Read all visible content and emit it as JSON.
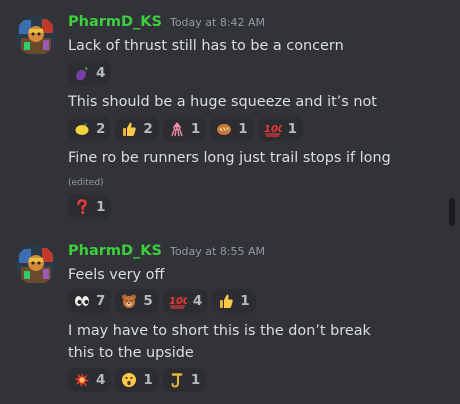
{
  "messages": [
    {
      "author": "PharmD_KS",
      "timestamp": "Today at 8:42 AM",
      "lines": [
        {
          "text": "Lack of thrust still has to be a concern",
          "reactions": [
            {
              "icon": "eggplant-emoji",
              "count": "4"
            }
          ]
        },
        {
          "text": "This should be a huge squeeze and it’s not",
          "reactions": [
            {
              "icon": "lemon-emoji",
              "count": "2"
            },
            {
              "icon": "thumbs-up-emoji",
              "count": "2"
            },
            {
              "icon": "squid-emoji",
              "count": "1"
            },
            {
              "icon": "bread-emoji",
              "count": "1"
            },
            {
              "icon": "hundred-points-emoji",
              "count": "1"
            }
          ]
        },
        {
          "text": "Fine ro be runners long just trail stops if long",
          "edited": "(edited)",
          "reactions": [
            {
              "icon": "question-mark-emoji",
              "count": "1"
            }
          ]
        }
      ]
    },
    {
      "author": "PharmD_KS",
      "timestamp": "Today at 8:55 AM",
      "lines": [
        {
          "text": "Feels very off",
          "reactions": [
            {
              "icon": "eyes-emoji",
              "count": "7"
            },
            {
              "icon": "bear-face-emoji",
              "count": "5"
            },
            {
              "icon": "hundred-points-emoji",
              "count": "4"
            },
            {
              "icon": "thumbs-up-emoji",
              "count": "1"
            }
          ]
        },
        {
          "text": "I may have to short this is the don’t break this to the upside",
          "reactions": [
            {
              "icon": "collision-emoji",
              "count": "4"
            },
            {
              "icon": "astonished-face-emoji",
              "count": "1"
            },
            {
              "icon": "hook-emoji",
              "count": "1"
            }
          ]
        }
      ]
    }
  ],
  "colors": {
    "background": "#313338",
    "username": "#3ecf3e",
    "message_text": "#dbdee1",
    "timestamp": "#949ba4",
    "reaction_pill": "#2b2d31"
  }
}
